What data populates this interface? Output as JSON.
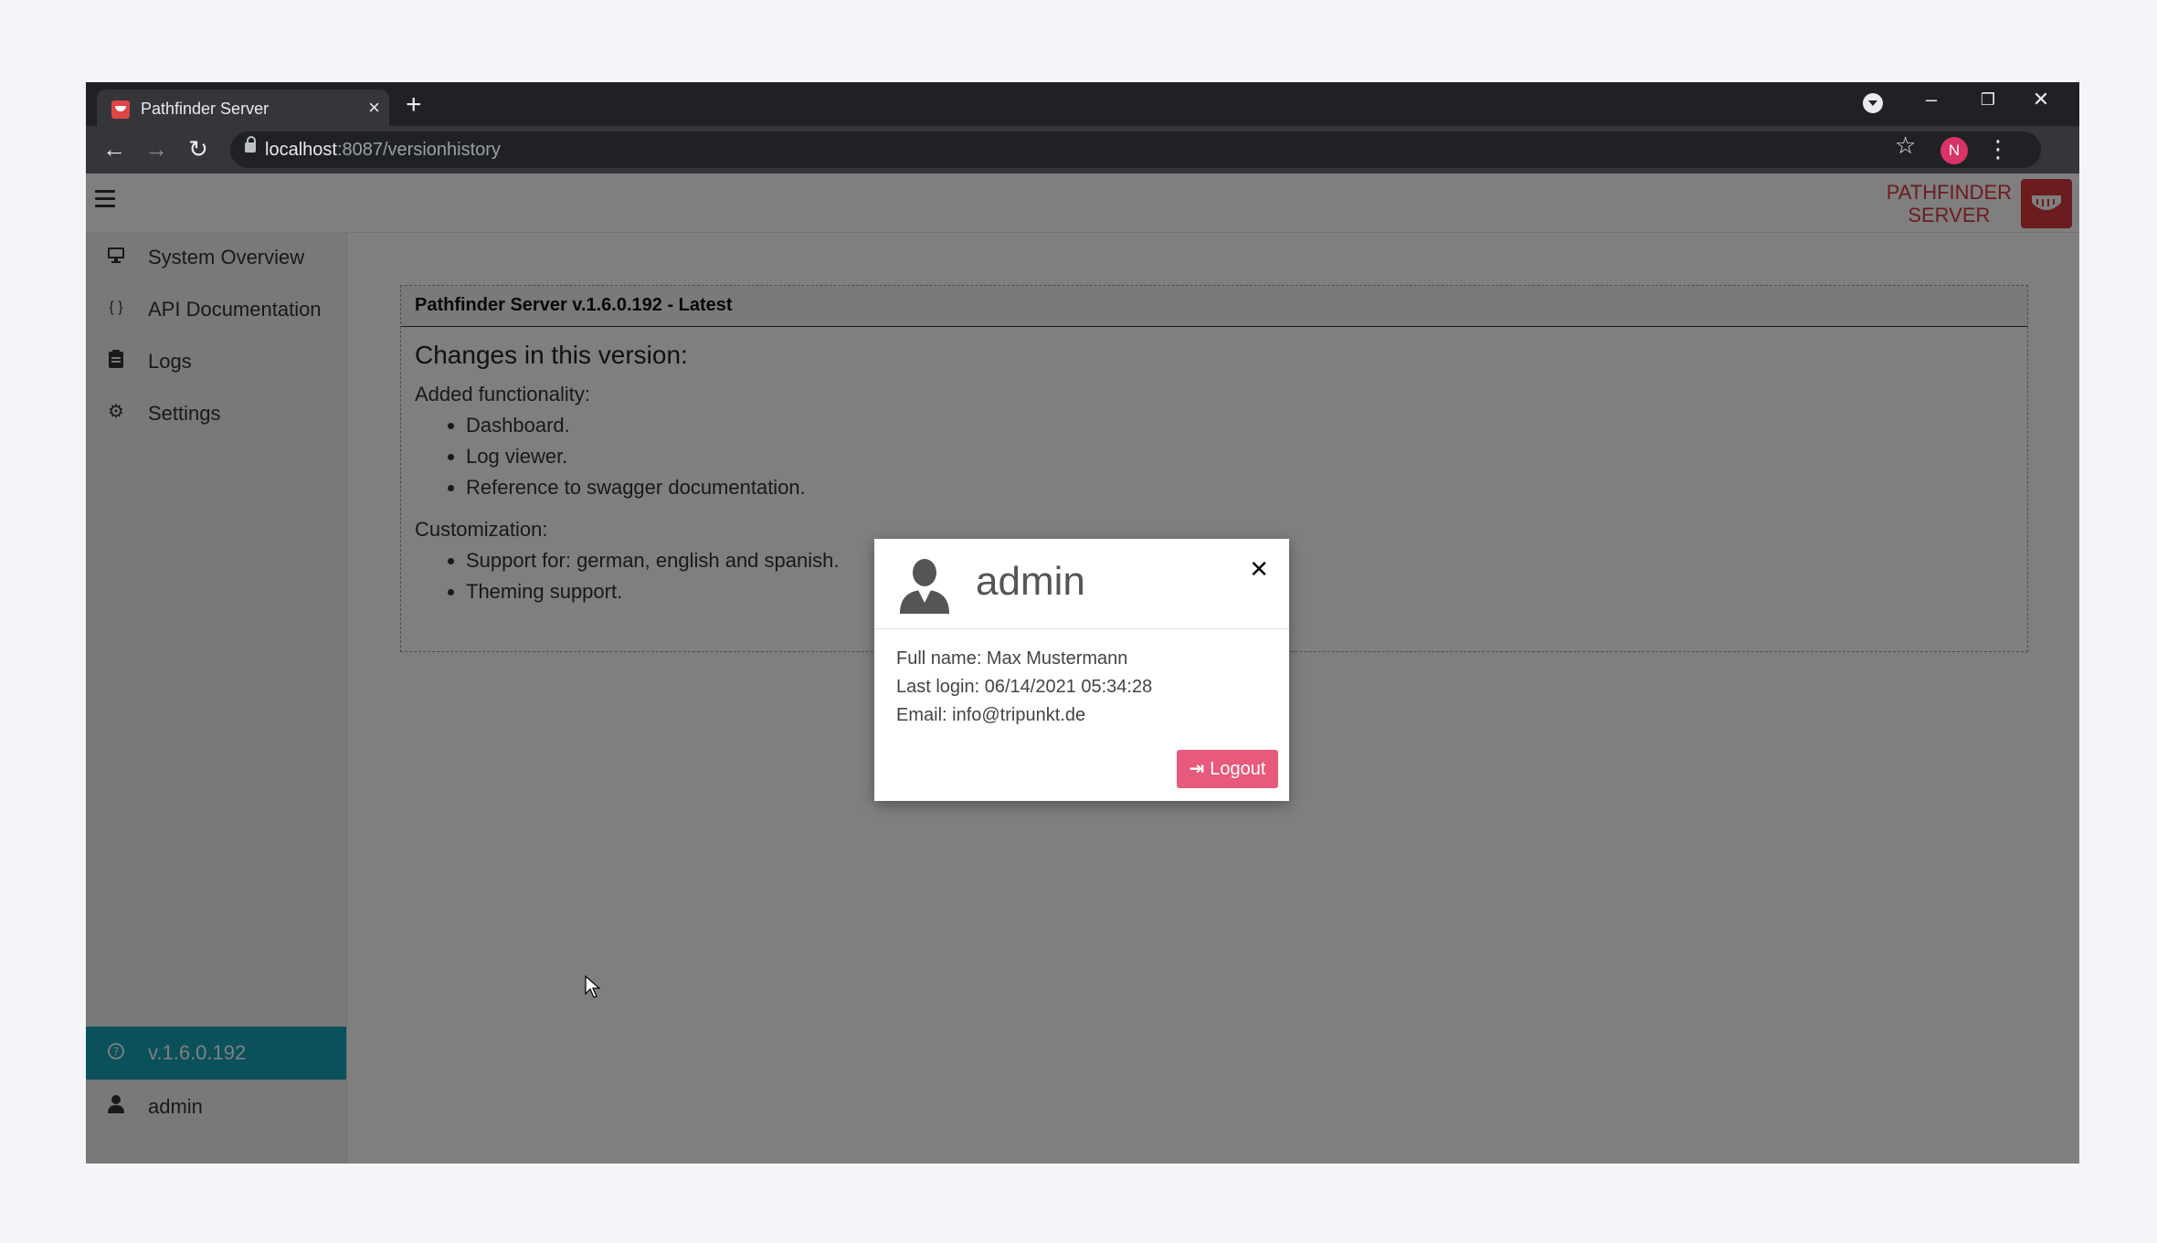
{
  "browser": {
    "tab_title": "Pathfinder Server",
    "url_host": "localhost",
    "url_path": ":8087/versionhistory",
    "profile_initial": "N"
  },
  "brand": {
    "line1": "PATHFINDER",
    "line2": "SERVER"
  },
  "sidebar": {
    "items": [
      {
        "label": "System Overview",
        "icon": "monitor-icon"
      },
      {
        "label": "API Documentation",
        "icon": "code-braces-icon"
      },
      {
        "label": "Logs",
        "icon": "clipboard-icon"
      },
      {
        "label": "Settings",
        "icon": "gear-icon"
      }
    ],
    "version": "v.1.6.0.192",
    "user": "admin"
  },
  "card": {
    "header": "Pathfinder Server v.1.6.0.192 - Latest",
    "heading": "Changes in this version:",
    "sections": [
      {
        "title": "Added functionality:",
        "items": [
          "Dashboard.",
          "Log viewer.",
          "Reference to swagger documentation."
        ]
      },
      {
        "title": "Customization:",
        "items": [
          "Support for: german, english and spanish.",
          "Theming support."
        ]
      }
    ]
  },
  "modal": {
    "title": "admin",
    "full_name": "Full name: Max Mustermann",
    "last_login": "Last login: 06/14/2021 05:34:28",
    "email": "Email: info@tripunkt.de",
    "logout_label": "Logout"
  },
  "colors": {
    "brand": "#d9363e",
    "version_bar": "#17a2b8",
    "logout_button": "#e75a7c"
  }
}
